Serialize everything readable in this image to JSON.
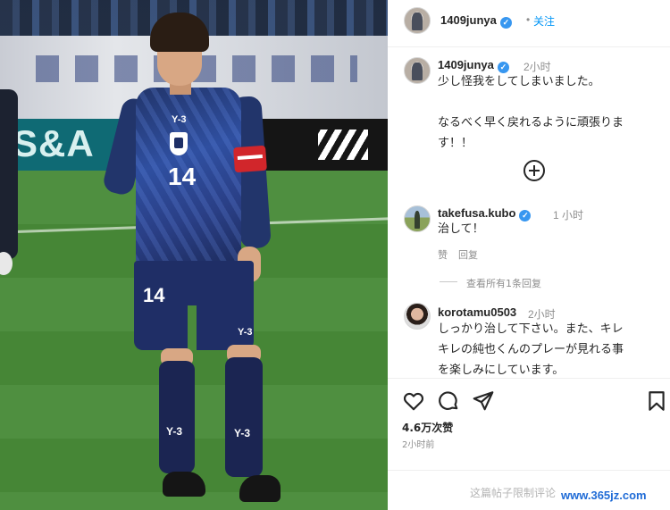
{
  "photo": {
    "adboard_text": "S&A",
    "kit_number_shirt": "14",
    "kit_number_shorts": "14",
    "kit_brand": "Y-3",
    "kit_brand_chest": "Y-3",
    "kit_brand_shorts": "Y-3"
  },
  "header": {
    "username": "1409junya",
    "follow_label": "关注",
    "separator": "•"
  },
  "caption": {
    "username": "1409junya",
    "time": "2小时",
    "line1": "少し怪我をしてしまいました。",
    "line2": "なるべく早く戻れるように頑張りま",
    "line3": "す！！"
  },
  "comments": [
    {
      "username": "takefusa.kubo",
      "time": "1 小时",
      "text": "治して！",
      "like_label": "赞",
      "reply_label": "回复",
      "view_replies": "查看所有1条回复"
    },
    {
      "username": "korotamu0503",
      "time": "2小时",
      "line1": "しっかり治して下さい。また、キレ",
      "line2": "キレの純也くんのプレーが見れる事",
      "line3": "を楽しみにしています。"
    }
  ],
  "actions": {
    "icons": [
      "heart-icon",
      "comment-icon",
      "share-icon",
      "bookmark-icon"
    ],
    "likes": "4.6万次赞",
    "post_time": "2小时前"
  },
  "footer": {
    "note": "这篇帖子限制评论"
  },
  "watermark": "www.365jz.com",
  "colors": {
    "verified": "#3897f0",
    "follow": "#0095f6",
    "watermark": "#1f6bd6"
  }
}
